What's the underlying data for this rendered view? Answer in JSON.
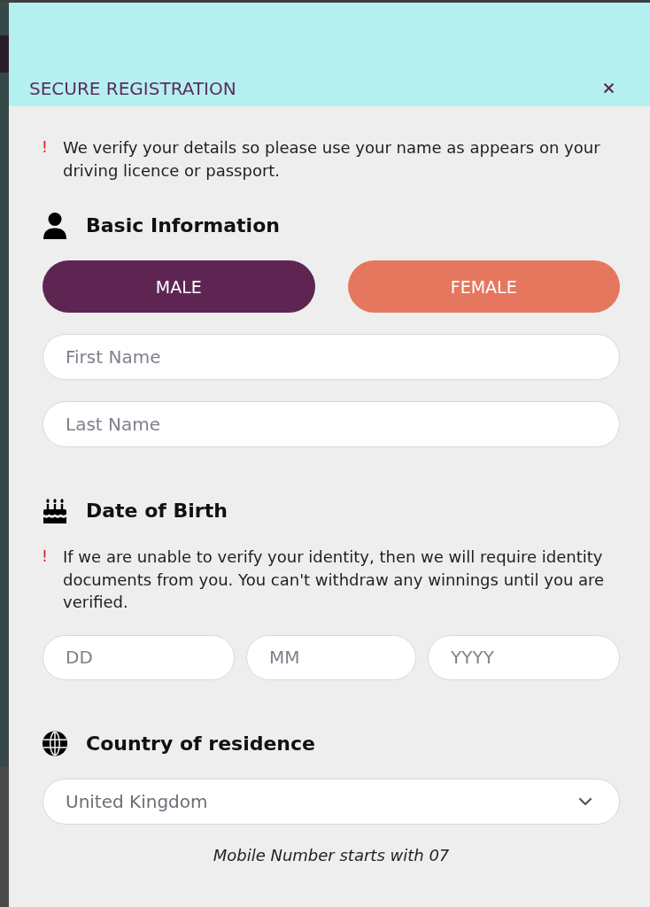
{
  "dialog": {
    "title": "SECURE REGISTRATION"
  },
  "notice": {
    "mark": "!",
    "text": "We verify your details so please use your name as appears on your driving licence or passport."
  },
  "basic_information": {
    "heading": "Basic Information",
    "gender_options": [
      {
        "label": "MALE",
        "color": "#5e2553"
      },
      {
        "label": "FEMALE",
        "color": "#e5775e"
      }
    ],
    "fields": [
      {
        "placeholder": "First Name"
      },
      {
        "placeholder": "Last Name"
      }
    ]
  },
  "date_of_birth": {
    "heading": "Date of Birth",
    "notice": {
      "mark": "!",
      "text": "If we are unable to verify your identity, then we will require identity documents from you. You can't withdraw any winnings until you are verified."
    },
    "fields": [
      {
        "placeholder": "DD"
      },
      {
        "placeholder": "MM"
      },
      {
        "placeholder": "YYYY"
      }
    ]
  },
  "country_of_residence": {
    "heading": "Country of residence",
    "select": {
      "value": "United Kingdom"
    }
  },
  "hint": "Mobile Number starts with 07"
}
